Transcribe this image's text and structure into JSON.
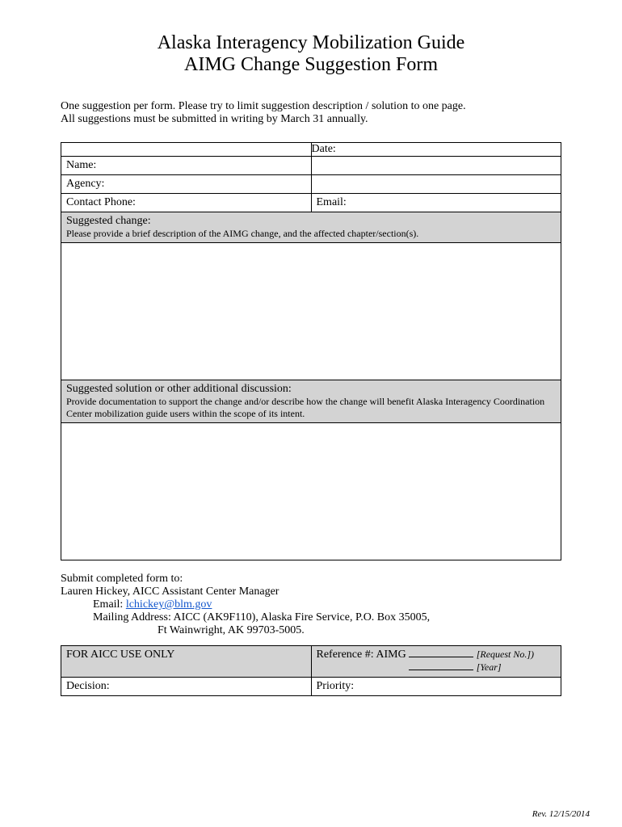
{
  "header": {
    "title_line1": "Alaska Interagency Mobilization Guide",
    "title_line2": "AIMG Change Suggestion Form"
  },
  "intro": {
    "line1": "One suggestion per form.  Please try to limit suggestion description / solution to one page.",
    "line2": "All suggestions must be submitted in writing by March 31 annually."
  },
  "fields": {
    "date_label": "Date:",
    "name_label": "Name:",
    "agency_label": "Agency:",
    "contact_phone_label": "Contact Phone:",
    "email_label": "Email:"
  },
  "suggested_change": {
    "label": "Suggested change:",
    "sub": "Please provide a brief description of the AIMG change, and the affected chapter/section(s)."
  },
  "suggested_solution": {
    "label": "Suggested solution or other additional discussion:",
    "sub": "Provide documentation to support the change and/or describe how the change will benefit Alaska Interagency Coordination Center mobilization guide users within the scope of its intent."
  },
  "submit": {
    "heading": "Submit completed form to:",
    "name_line": "Lauren Hickey, AICC Assistant Center Manager",
    "email_label": "Email: ",
    "email_value": "lchickey@blm.gov",
    "mailing_label": "Mailing Address: AICC (AK9F110), Alaska Fire Service, P.O. Box 35005,",
    "mailing_line2": "Ft Wainwright, AK 99703-5005."
  },
  "aicc": {
    "header_label": "FOR AICC USE ONLY",
    "reference_label": "Reference #: AIMG",
    "request_no_hint": "[Request No.])",
    "year_hint": "[Year]",
    "decision_label": "Decision:",
    "priority_label": "Priority:"
  },
  "footer": {
    "rev": "Rev. 12/15/2014"
  }
}
